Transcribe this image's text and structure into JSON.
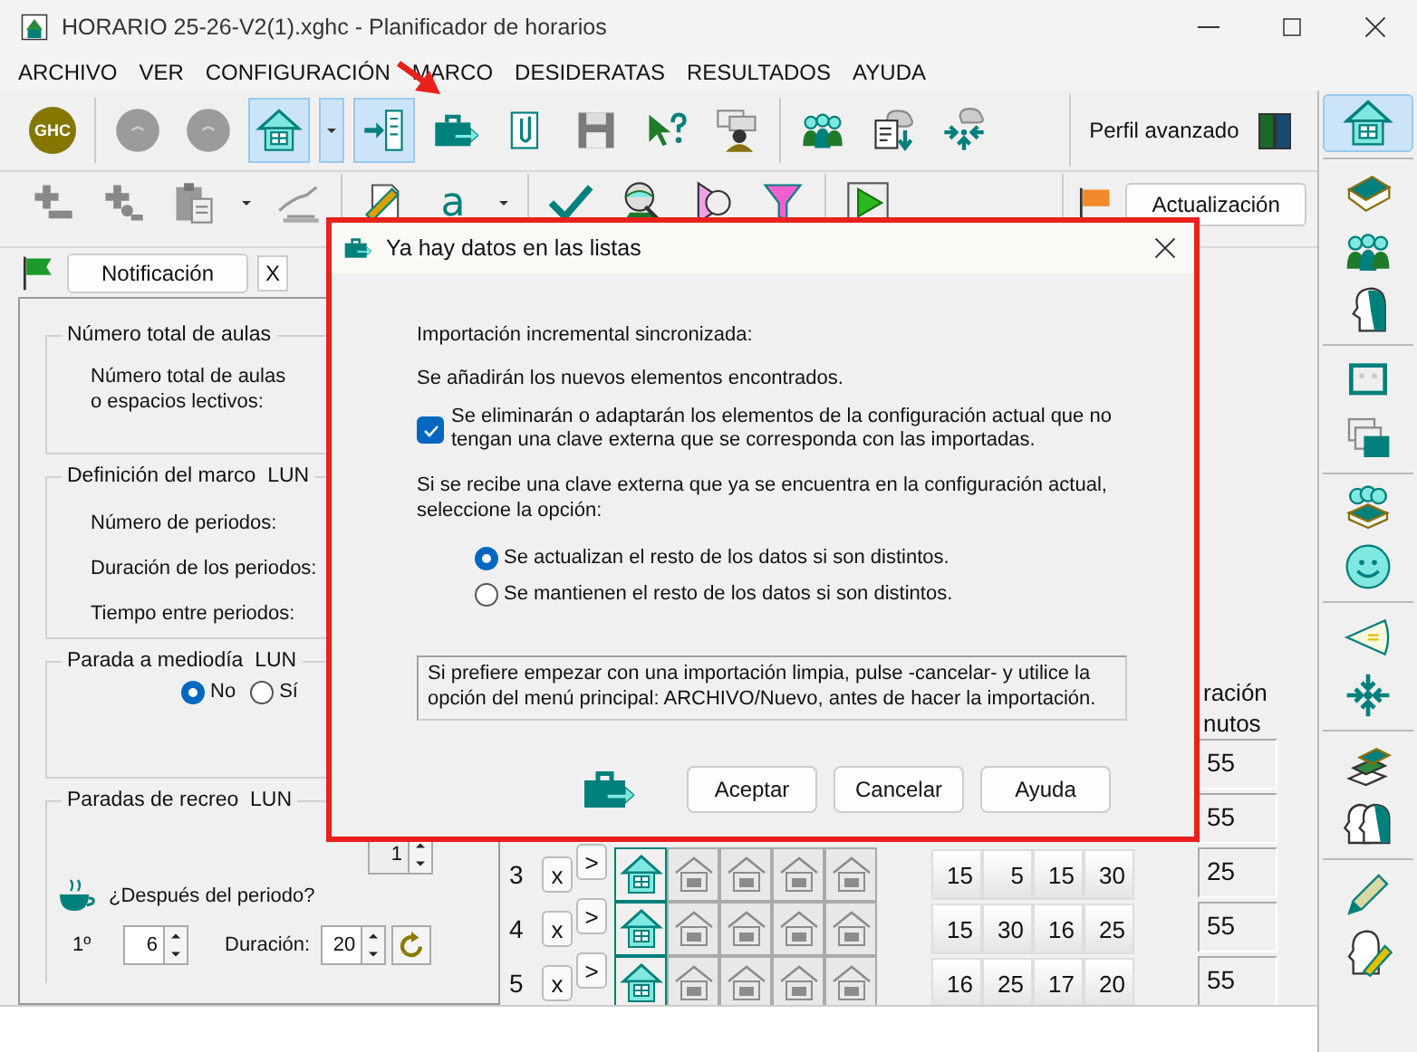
{
  "window": {
    "title": "HORARIO 25-26-V2(1).xghc - Planificador de horarios"
  },
  "menu": [
    "ARCHIVO",
    "VER",
    "CONFIGURACIÓN",
    "MARCO",
    "DESIDERATAS",
    "RESULTADOS",
    "AYUDA"
  ],
  "toolbar": {
    "groups": [
      [
        {
          "kind": "logo",
          "label": "GHC",
          "pressed": false
        }
      ],
      [
        {
          "kind": "circle",
          "pressed": false
        },
        {
          "kind": "circle",
          "pressed": false
        },
        {
          "kind": "home",
          "pressed": true
        },
        {
          "kind": "caret",
          "pressed": true
        },
        {
          "kind": "import",
          "pressed": true
        },
        {
          "kind": "briefcase",
          "pressed": false
        },
        {
          "kind": "clip",
          "pressed": false
        },
        {
          "kind": "floppy",
          "pressed": false
        },
        {
          "kind": "help",
          "pressed": false
        },
        {
          "kind": "speaker",
          "pressed": false
        }
      ],
      [
        {
          "kind": "people",
          "pressed": false
        },
        {
          "kind": "doccloud",
          "pressed": false
        },
        {
          "kind": "arrows",
          "pressed": false
        }
      ]
    ],
    "profile_button": "Perfil avanzado"
  },
  "toolbar2": {
    "groups": [
      [
        {
          "kind": "plus"
        },
        {
          "kind": "plus2"
        },
        {
          "kind": "paste"
        },
        {
          "kind": "caret"
        },
        {
          "kind": "hand"
        }
      ],
      [
        {
          "kind": "edit"
        },
        {
          "kind": "letter",
          "label": "a"
        },
        {
          "kind": "caret"
        }
      ],
      [
        {
          "kind": "check"
        },
        {
          "kind": "magnify"
        },
        {
          "kind": "cone"
        },
        {
          "kind": "funnel"
        }
      ],
      [
        {
          "kind": "play"
        }
      ]
    ],
    "update_button": "Actualización"
  },
  "notification": {
    "button": "Notificación",
    "close": "X"
  },
  "classrooms": {
    "title": "Número total de aulas",
    "label": "Número total de aulas\no espacios lectivos:"
  },
  "frame": {
    "title": "Definición del marco  LUN",
    "fields": [
      "Número de periodos:",
      "Duración de los periodos:",
      "Tiempo entre periodos:"
    ]
  },
  "midday": {
    "title": "Parada a mediodía  LUN",
    "options": [
      {
        "label": "No",
        "selected": true
      },
      {
        "label": "Sí",
        "selected": false
      }
    ]
  },
  "breaks": {
    "title": "Paradas de recreo  LUN",
    "count": "1",
    "question": "¿Después del periodo?",
    "ordinal": "1º",
    "after": "6",
    "duration_label": "Duración:",
    "duration": "20"
  },
  "schedule": {
    "duration_header": "ración\nnutos",
    "rows": [
      {
        "duration": "55"
      },
      {
        "duration": "55"
      },
      {
        "number": "3",
        "remove": "x",
        "move": ">",
        "times": [
          "15",
          "5",
          "15",
          "30"
        ],
        "duration": "25"
      },
      {
        "number": "4",
        "remove": "x",
        "move": ">",
        "times": [
          "15",
          "30",
          "16",
          "25"
        ],
        "duration": "55"
      },
      {
        "number": "5",
        "remove": "x",
        "move": ">",
        "times": [
          "16",
          "25",
          "17",
          "20"
        ],
        "duration": "55"
      }
    ]
  },
  "sidebar": {
    "groups": [
      [
        {
          "kind": "home",
          "pressed": true
        }
      ],
      [
        {
          "kind": "book",
          "pressed": false
        },
        {
          "kind": "people",
          "pressed": false
        },
        {
          "kind": "head",
          "pressed": false
        }
      ],
      [
        {
          "kind": "screen",
          "pressed": false
        },
        {
          "kind": "windows",
          "pressed": false
        }
      ],
      [
        {
          "kind": "groupbook",
          "pressed": false
        },
        {
          "kind": "smiley",
          "pressed": false
        }
      ],
      [
        {
          "kind": "triangle",
          "pressed": false
        },
        {
          "kind": "arrowsin",
          "pressed": false
        }
      ],
      [
        {
          "kind": "books",
          "pressed": false
        },
        {
          "kind": "heads",
          "pressed": false
        }
      ],
      [
        {
          "kind": "pencil",
          "pressed": false
        },
        {
          "kind": "headpencil",
          "pressed": false
        }
      ]
    ]
  },
  "dialog": {
    "title": "Ya hay datos en las listas",
    "heading": "Importación incremental sincronizada:",
    "info": "Se añadirán los nuevos elementos encontrados.",
    "remove_option": {
      "label": "Se eliminarán o adaptarán los elementos de la configuración actual que no tengan una clave externa que se corresponda con las importadas.",
      "checked": true
    },
    "question": "Si se recibe una clave externa que ya se encuentra en la configuración actual, seleccione la opción:",
    "options": [
      {
        "label": "Se actualizan el resto de los datos si son distintos.",
        "selected": true
      },
      {
        "label": "Se mantienen el resto de los datos si son distintos.",
        "selected": false
      }
    ],
    "note": "Si prefiere empezar con una importación limpia, pulse -cancelar- y utilice la opción del menú principal: ARCHIVO/Nuevo, antes de hacer la importación.",
    "buttons": [
      "Aceptar",
      "Cancelar",
      "Ayuda"
    ]
  }
}
